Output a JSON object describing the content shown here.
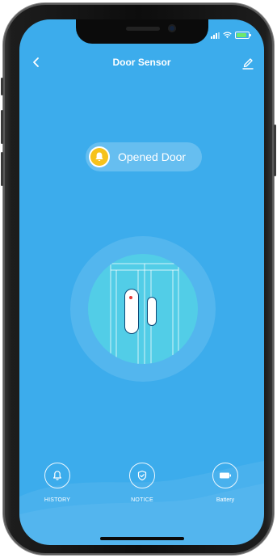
{
  "header": {
    "title": "Door Sensor",
    "back_icon": "chevron-left-icon",
    "edit_icon": "pencil-icon"
  },
  "status": {
    "label": "Opened Door",
    "icon": "bell-icon"
  },
  "device": {
    "illustration": "door-sensor-icon"
  },
  "nav": {
    "items": [
      {
        "label": "HISTORY",
        "icon": "bell-icon"
      },
      {
        "label": "NOTICE",
        "icon": "shield-check-icon"
      },
      {
        "label": "Battery",
        "icon": "battery-icon"
      }
    ]
  },
  "colors": {
    "background": "#3cacec",
    "alert_yellow": "#f6c21b",
    "sensor_disc": "#52cde7",
    "indicator_red": "#e53935"
  }
}
